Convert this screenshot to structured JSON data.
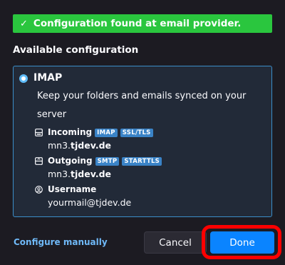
{
  "banner": {
    "icon": "check-icon",
    "text": "Configuration found at email provider."
  },
  "section_title": "Available configuration",
  "config": {
    "protocol": "IMAP",
    "description": "Keep your folders and emails synced on your server",
    "incoming": {
      "label": "Incoming",
      "icon": "incoming-server-icon",
      "tags": [
        "IMAP",
        "SSL/TLS"
      ],
      "host_prefix": "mn3.",
      "host_domain": "tjdev.de"
    },
    "outgoing": {
      "label": "Outgoing",
      "icon": "outgoing-server-icon",
      "tags": [
        "SMTP",
        "STARTTLS"
      ],
      "host_prefix": "mn3.",
      "host_domain": "tjdev.de"
    },
    "username": {
      "label": "Username",
      "icon": "user-icon",
      "value": "yourmail@tjdev.de"
    }
  },
  "footer": {
    "configure_manually": "Configure manually",
    "cancel_label": "Cancel",
    "done_label": "Done"
  },
  "colors": {
    "background": "#1c1b22",
    "banner": "#2ac63e",
    "box_border": "#3b8ec9",
    "tag": "#3a83c7",
    "link": "#6fb9f8",
    "primary_button": "#0a84ff",
    "highlight": "#ff0000"
  }
}
